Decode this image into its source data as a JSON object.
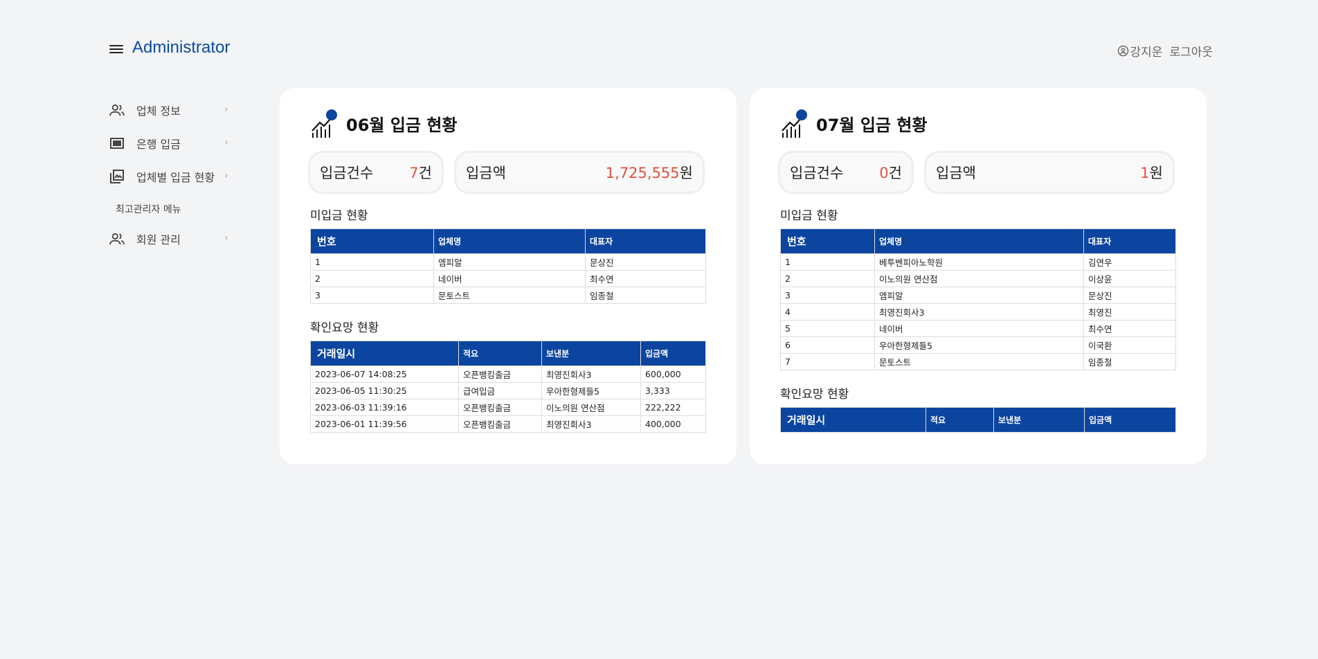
{
  "header": {
    "title": "Administrator",
    "user_name": "강지운",
    "logout_label": "로그아웃"
  },
  "sidebar": {
    "items": [
      {
        "label": "업체 정보",
        "icon": "users-icon"
      },
      {
        "label": "은행 입금",
        "icon": "card-icon"
      },
      {
        "label": "업체별 입금 현황",
        "icon": "gallery-icon"
      }
    ],
    "section_label": "최고관리자 메뉴",
    "admin_items": [
      {
        "label": "회원 관리",
        "icon": "users-icon"
      }
    ]
  },
  "cards": [
    {
      "title": "06월 입금 현황",
      "count_label": "입금건수",
      "count_value": "7",
      "count_unit": "건",
      "amount_label": "입금액",
      "amount_value": "1,725,555",
      "amount_unit": "원",
      "unpaid_label": "미입금 현황",
      "unpaid_headers": [
        "번호",
        "업체명",
        "대표자"
      ],
      "unpaid_rows": [
        [
          "1",
          "엠피알",
          "문상진"
        ],
        [
          "2",
          "네이버",
          "최수연"
        ],
        [
          "3",
          "문토스트",
          "임종철"
        ]
      ],
      "check_label": "확인요망 현황",
      "check_headers": [
        "거래일시",
        "적요",
        "보낸분",
        "입금액"
      ],
      "check_rows": [
        [
          "2023-06-07 14:08:25",
          "오픈뱅킹출금",
          "최영진회사3",
          "600,000"
        ],
        [
          "2023-06-05 11:30:25",
          "급여입금",
          "우아한형제들5",
          "3,333"
        ],
        [
          "2023-06-03 11:39:16",
          "오픈뱅킹출금",
          "이노의원 연산점",
          "222,222"
        ],
        [
          "2023-06-01 11:39:56",
          "오픈뱅킹출금",
          "최영진회사3",
          "400,000"
        ]
      ]
    },
    {
      "title": "07월 입금 현황",
      "count_label": "입금건수",
      "count_value": "0",
      "count_unit": "건",
      "amount_label": "입금액",
      "amount_value": "1",
      "amount_unit": "원",
      "unpaid_label": "미입금 현황",
      "unpaid_headers": [
        "번호",
        "업체명",
        "대표자"
      ],
      "unpaid_rows": [
        [
          "1",
          "베투벤피아노학원",
          "김연우"
        ],
        [
          "2",
          "이노의원 연산점",
          "이상윤"
        ],
        [
          "3",
          "엠피알",
          "문상진"
        ],
        [
          "4",
          "최영진회사3",
          "최영진"
        ],
        [
          "5",
          "네이버",
          "최수연"
        ],
        [
          "6",
          "우아한형제들5",
          "이국환"
        ],
        [
          "7",
          "문토스트",
          "임종철"
        ]
      ],
      "check_label": "확인요망 현황",
      "check_headers": [
        "거래일시",
        "적요",
        "보낸분",
        "입금액"
      ],
      "check_rows": []
    }
  ],
  "colors": {
    "brand": "#0a4aa0",
    "table_header": "#0b45a0",
    "accent_number": "#e0533f",
    "stat_badge": "#0b45a0"
  }
}
